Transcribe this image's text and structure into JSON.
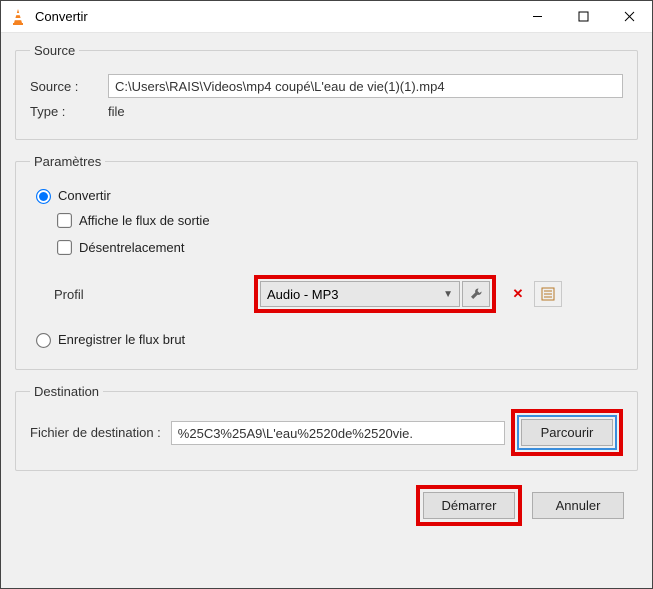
{
  "title": "Convertir",
  "source": {
    "legend": "Source",
    "label": "Source :",
    "value": "C:\\Users\\RAIS\\Videos\\mp4 coupé\\L'eau de vie(1)(1).mp4",
    "typeLabel": "Type :",
    "typeValue": "file"
  },
  "params": {
    "legend": "Paramètres",
    "radioConvert": "Convertir",
    "checkShow": "Affiche le flux de sortie",
    "checkDeint": "Désentrelacement",
    "profilLabel": "Profil",
    "profilValue": "Audio - MP3",
    "radioRaw": "Enregistrer le flux brut"
  },
  "dest": {
    "legend": "Destination",
    "label": "Fichier de destination :",
    "value": "%25C3%25A9\\L'eau%2520de%2520vie.",
    "browse": "Parcourir"
  },
  "buttons": {
    "start": "Démarrer",
    "cancel": "Annuler"
  }
}
